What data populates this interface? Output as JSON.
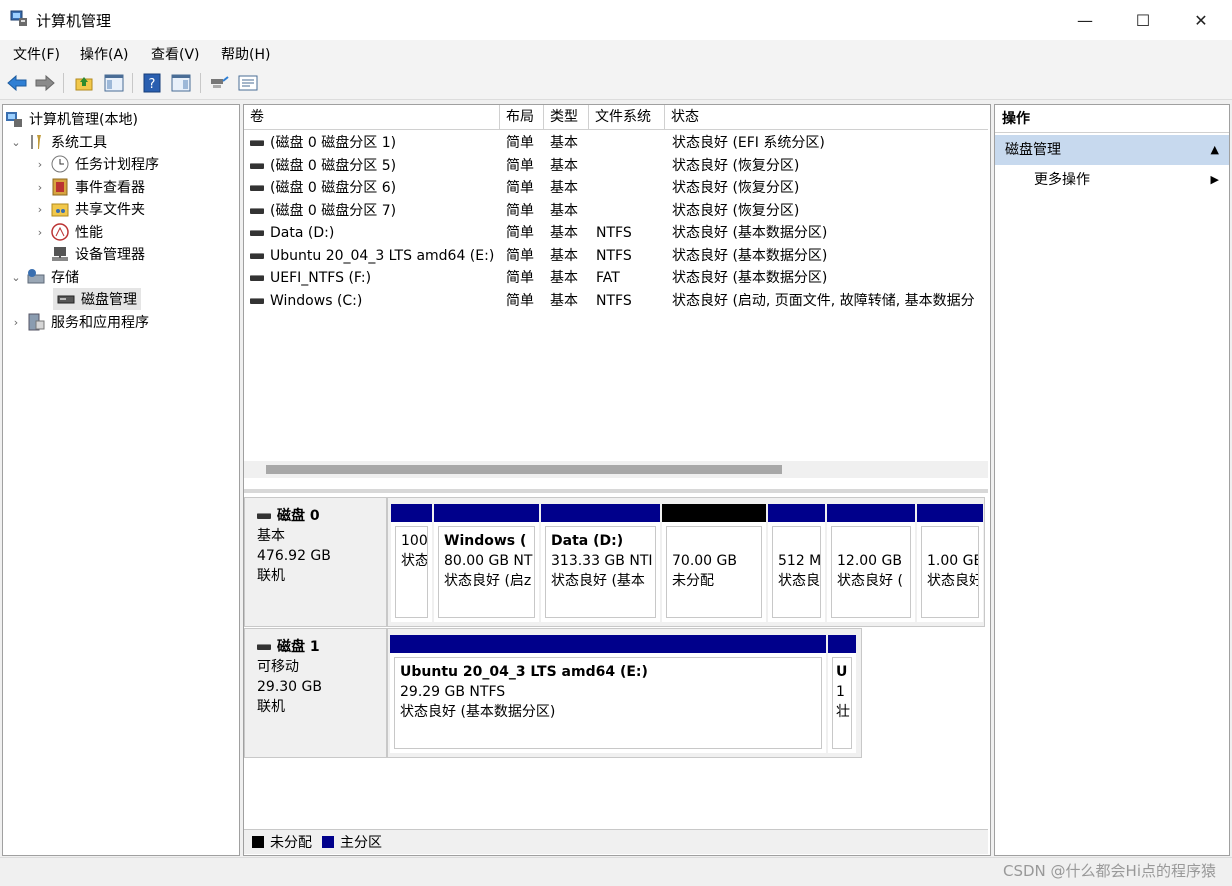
{
  "window": {
    "title": "计算机管理"
  },
  "menu": [
    "文件(F)",
    "操作(A)",
    "查看(V)",
    "帮助(H)"
  ],
  "tree": {
    "root": "计算机管理(本地)",
    "system_tools": "系统工具",
    "task_scheduler": "任务计划程序",
    "event_viewer": "事件查看器",
    "shared_folders": "共享文件夹",
    "performance": "性能",
    "device_manager": "设备管理器",
    "storage": "存储",
    "disk_management": "磁盘管理",
    "services": "服务和应用程序"
  },
  "list": {
    "headers": [
      "卷",
      "布局",
      "类型",
      "文件系统",
      "状态"
    ],
    "rows": [
      [
        "(磁盘 0 磁盘分区 1)",
        "简单",
        "基本",
        "",
        "状态良好 (EFI 系统分区)"
      ],
      [
        "(磁盘 0 磁盘分区 5)",
        "简单",
        "基本",
        "",
        "状态良好 (恢复分区)"
      ],
      [
        "(磁盘 0 磁盘分区 6)",
        "简单",
        "基本",
        "",
        "状态良好 (恢复分区)"
      ],
      [
        "(磁盘 0 磁盘分区 7)",
        "简单",
        "基本",
        "",
        "状态良好 (恢复分区)"
      ],
      [
        "Data (D:)",
        "简单",
        "基本",
        "NTFS",
        "状态良好 (基本数据分区)"
      ],
      [
        "Ubuntu 20_04_3 LTS amd64 (E:)",
        "简单",
        "基本",
        "NTFS",
        "状态良好 (基本数据分区)"
      ],
      [
        "UEFI_NTFS (F:)",
        "简单",
        "基本",
        "FAT",
        "状态良好 (基本数据分区)"
      ],
      [
        "Windows (C:)",
        "简单",
        "基本",
        "NTFS",
        "状态良好 (启动, 页面文件, 故障转储, 基本数据分"
      ]
    ]
  },
  "disk0": {
    "name": "磁盘 0",
    "type": "基本",
    "size": "476.92 GB",
    "status": "联机",
    "partitions": [
      {
        "title": "",
        "line1": "100",
        "line2": "状态"
      },
      {
        "title": "Windows  (",
        "line1": "80.00 GB NT",
        "line2": "状态良好 (启z"
      },
      {
        "title": "Data  (D:)",
        "line1": "313.33 GB NTI",
        "line2": "状态良好 (基本"
      },
      {
        "title": "",
        "line1": "70.00 GB",
        "line2": "未分配"
      },
      {
        "title": "",
        "line1": "512 M",
        "line2": "状态良"
      },
      {
        "title": "",
        "line1": "12.00 GB",
        "line2": "状态良好 ("
      },
      {
        "title": "",
        "line1": "1.00 GE",
        "line2": "状态良好"
      }
    ]
  },
  "disk1": {
    "name": "磁盘 1",
    "type": "可移动",
    "size": "29.30 GB",
    "status": "联机",
    "partitions": [
      {
        "title": "Ubuntu 20_04_3 LTS amd64  (E:)",
        "line1": "29.29 GB NTFS",
        "line2": "状态良好 (基本数据分区)"
      },
      {
        "title": "U",
        "line1": "1",
        "line2": "壮"
      }
    ]
  },
  "legend": {
    "unallocated": "未分配",
    "primary": "主分区"
  },
  "actions": {
    "header": "操作",
    "section": "磁盘管理",
    "more": "更多操作"
  },
  "watermark": "CSDN @什么都会Hi点的程序猿",
  "colors": {
    "primary_partition": "#00008b",
    "unallocated": "#000000",
    "selection": "#cce8ff",
    "actions_section_bg": "#c7d9ee"
  }
}
